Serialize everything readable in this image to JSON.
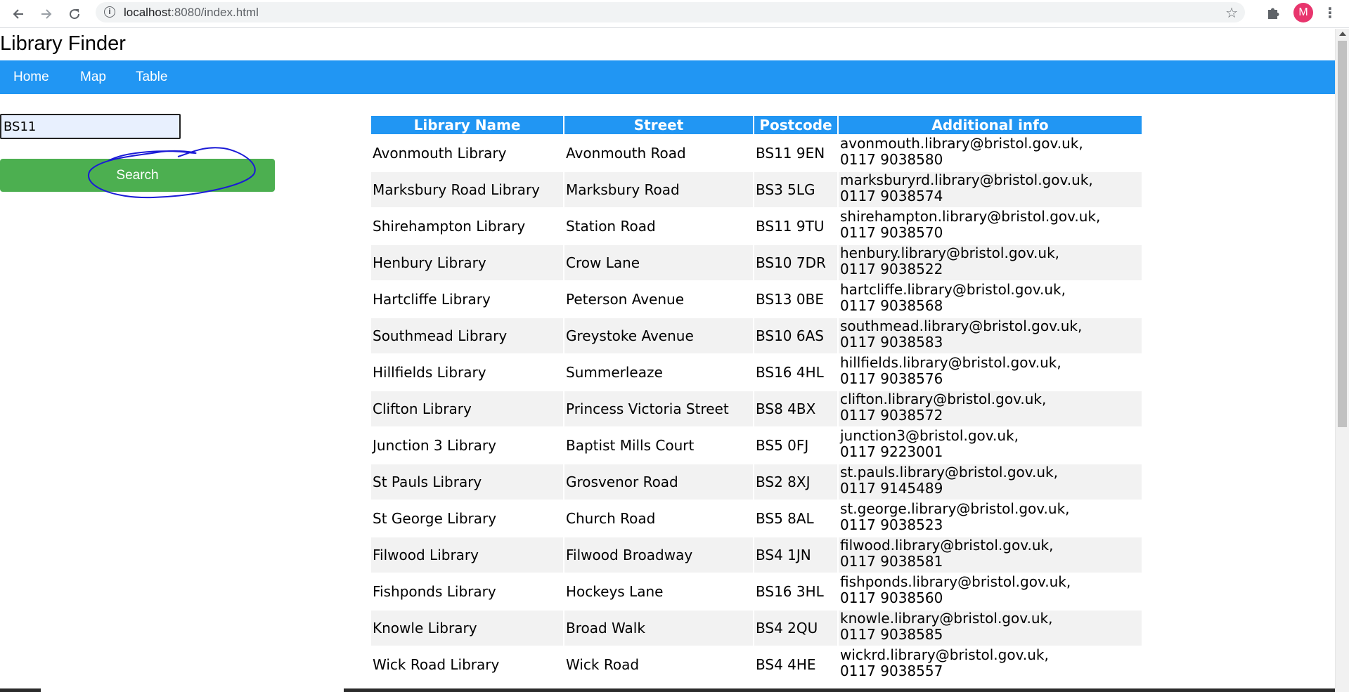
{
  "browser": {
    "url_host": "localhost",
    "url_path": ":8080/index.html",
    "avatar_letter": "M",
    "back_icon": "arrow-left-icon",
    "forward_icon": "arrow-right-icon",
    "reload_icon": "reload-icon",
    "info_icon": "info-icon",
    "bookmark_icon": "star-icon",
    "extensions_icon": "puzzle-icon",
    "menu_icon": "more-vertical-icon"
  },
  "app": {
    "title": "Library Finder"
  },
  "navbar": {
    "color": "#2196f3",
    "items": [
      {
        "label": "Home"
      },
      {
        "label": "Map"
      },
      {
        "label": "Table"
      }
    ]
  },
  "search": {
    "value": "BS11",
    "button_label": "Search",
    "button_color": "#4caf50"
  },
  "table": {
    "headers": [
      "Library Name",
      "Street",
      "Postcode",
      "Additional info"
    ],
    "rows": [
      {
        "name": "Avonmouth Library",
        "street": "Avonmouth Road",
        "postcode": "BS11 9EN",
        "email": "avonmouth.library@bristol.gov.uk,",
        "phone": "0117 9038580"
      },
      {
        "name": "Marksbury Road Library",
        "street": "Marksbury Road",
        "postcode": "BS3 5LG",
        "email": "marksburyrd.library@bristol.gov.uk,",
        "phone": "0117 9038574"
      },
      {
        "name": "Shirehampton Library",
        "street": "Station Road",
        "postcode": "BS11 9TU",
        "email": "shirehampton.library@bristol.gov.uk,",
        "phone": "0117 9038570"
      },
      {
        "name": "Henbury Library",
        "street": "Crow Lane",
        "postcode": "BS10 7DR",
        "email": "henbury.library@bristol.gov.uk,",
        "phone": "0117 9038522"
      },
      {
        "name": "Hartcliffe Library",
        "street": "Peterson Avenue",
        "postcode": "BS13 0BE",
        "email": "hartcliffe.library@bristol.gov.uk,",
        "phone": "0117 9038568"
      },
      {
        "name": "Southmead Library",
        "street": "Greystoke Avenue",
        "postcode": "BS10 6AS",
        "email": "southmead.library@bristol.gov.uk,",
        "phone": "0117 9038583"
      },
      {
        "name": "Hillfields Library",
        "street": "Summerleaze",
        "postcode": "BS16 4HL",
        "email": "hillfields.library@bristol.gov.uk,",
        "phone": "0117 9038576"
      },
      {
        "name": "Clifton Library",
        "street": "Princess Victoria Street",
        "postcode": "BS8 4BX",
        "email": "clifton.library@bristol.gov.uk,",
        "phone": "0117 9038572"
      },
      {
        "name": "Junction 3 Library",
        "street": "Baptist Mills Court",
        "postcode": "BS5 0FJ",
        "email": "junction3@bristol.gov.uk,",
        "phone": "0117 9223001"
      },
      {
        "name": "St Pauls Library",
        "street": "Grosvenor Road",
        "postcode": "BS2 8XJ",
        "email": "st.pauls.library@bristol.gov.uk,",
        "phone": "0117 9145489"
      },
      {
        "name": "St George Library",
        "street": "Church Road",
        "postcode": "BS5 8AL",
        "email": "st.george.library@bristol.gov.uk,",
        "phone": "0117 9038523"
      },
      {
        "name": "Filwood Library",
        "street": "Filwood Broadway",
        "postcode": "BS4 1JN",
        "email": "filwood.library@bristol.gov.uk,",
        "phone": "0117 9038581"
      },
      {
        "name": "Fishponds Library",
        "street": "Hockeys Lane",
        "postcode": "BS16 3HL",
        "email": "fishponds.library@bristol.gov.uk,",
        "phone": "0117 9038560"
      },
      {
        "name": "Knowle Library",
        "street": "Broad Walk",
        "postcode": "BS4 2QU",
        "email": "knowle.library@bristol.gov.uk,",
        "phone": "0117 9038585"
      },
      {
        "name": "Wick Road Library",
        "street": "Wick Road",
        "postcode": "BS4 4HE",
        "email": "wickrd.library@bristol.gov.uk,",
        "phone": "0117 9038557"
      }
    ]
  }
}
